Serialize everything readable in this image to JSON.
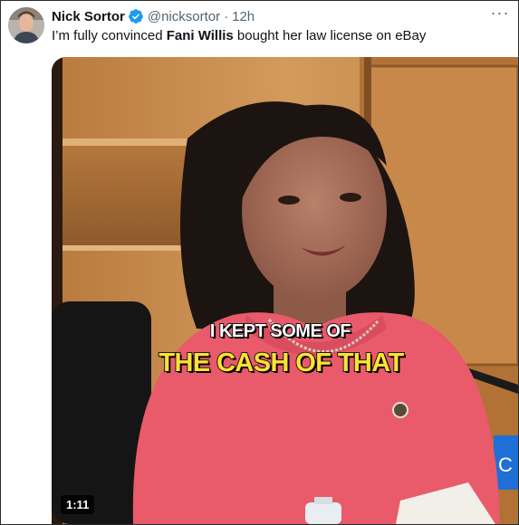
{
  "tweet": {
    "author_name": "Nick Sortor",
    "handle": "@nicksortor",
    "separator": "·",
    "timestamp": "12h",
    "text_before": "I’m fully convinced ",
    "text_bold": "Fani Willis",
    "text_after": " bought her law license on eBay",
    "more_label": "···"
  },
  "video": {
    "caption_line1": "I KEPT SOME OF",
    "caption_line2": "THE CASH OF THAT",
    "duration": "1:11"
  },
  "colors": {
    "verified_badge": "#1d9bf0",
    "secondary_text": "#536471",
    "caption_highlight": "#ffe034"
  }
}
